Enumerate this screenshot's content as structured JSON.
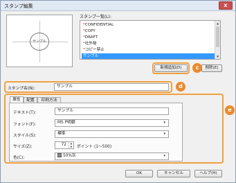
{
  "window": {
    "title": "スタンプ編集",
    "close_glyph": "x"
  },
  "preview": {
    "stamp_text": "サンプル"
  },
  "stamp_list": {
    "label": "スタンプ一覧(L):",
    "items": [
      {
        "mark": "*",
        "label": "CONFIDENTIAL",
        "selected": false
      },
      {
        "mark": "*",
        "label": "COPY",
        "selected": false
      },
      {
        "mark": "*",
        "label": "DRAFT",
        "selected": false
      },
      {
        "mark": "*",
        "label": "社外秘",
        "selected": false
      },
      {
        "mark": "*",
        "label": "コピー禁止",
        "selected": false
      },
      {
        "mark": "",
        "label": "サンプル",
        "selected": true
      }
    ],
    "scroll_up": "▲",
    "scroll_down": "▼"
  },
  "buttons": {
    "add_new": "新規追加(D)",
    "delete": "削除(E)",
    "ok": "OK",
    "cancel": "キャンセル",
    "help": "ヘルプ(H)"
  },
  "stamp_name": {
    "label": "スタンプ名(N):",
    "value": "サンプル"
  },
  "tabs": [
    {
      "label": "属性",
      "active": true
    },
    {
      "label": "配置",
      "active": false
    },
    {
      "label": "印刷方法",
      "active": false
    }
  ],
  "attributes": {
    "text": {
      "label": "テキスト(T):",
      "value": "サンプル"
    },
    "font": {
      "label": "フォント(F):",
      "value": "MS P明朝"
    },
    "style": {
      "label": "スタイル(S):",
      "value": "標準"
    },
    "size": {
      "label": "サイズ(Z):",
      "value": "72",
      "range": "ポイント (1〜500)"
    },
    "color": {
      "label": "色(C):",
      "value": "50%灰"
    }
  },
  "callouts": {
    "c": "c",
    "d": "d",
    "e": "e"
  },
  "colors": {
    "accent": "#e98a2c",
    "selection": "#3399ff",
    "required_mark": "#d02020"
  },
  "icons": {
    "dropdown": "▾",
    "spin_up": "▲",
    "spin_down": "▼"
  }
}
